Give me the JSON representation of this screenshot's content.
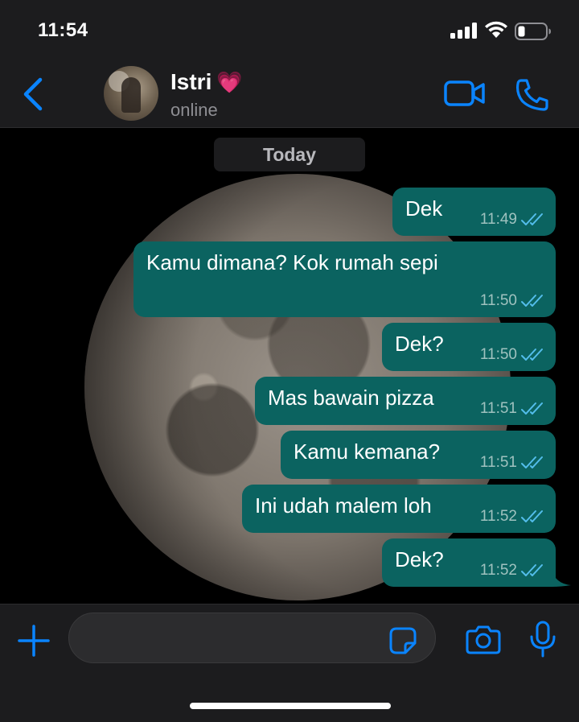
{
  "status_bar": {
    "time": "11:54"
  },
  "header": {
    "contact_name": "Istri",
    "contact_emoji": "💗",
    "contact_status": "online"
  },
  "chat": {
    "date_label": "Today",
    "messages": [
      {
        "text": "Dek",
        "time": "11:49",
        "read": true
      },
      {
        "text": "Kamu dimana? Kok rumah sepi",
        "time": "11:50",
        "read": true
      },
      {
        "text": "Dek?",
        "time": "11:50",
        "read": true
      },
      {
        "text": "Mas bawain pizza",
        "time": "11:51",
        "read": true
      },
      {
        "text": "Kamu kemana?",
        "time": "11:51",
        "read": true
      },
      {
        "text": "Ini udah malem loh",
        "time": "11:52",
        "read": true
      },
      {
        "text": "Dek?",
        "time": "11:52",
        "read": true
      }
    ]
  },
  "input_bar": {
    "placeholder": ""
  },
  "colors": {
    "accent": "#0a84ff",
    "outgoing_bubble": "#0b6360",
    "read_ticks": "#53bdeb",
    "bar_background": "#1c1c1e"
  },
  "icons": [
    "back-chevron-icon",
    "video-call-icon",
    "phone-call-icon",
    "plus-icon",
    "sticker-icon",
    "camera-icon",
    "microphone-icon"
  ]
}
